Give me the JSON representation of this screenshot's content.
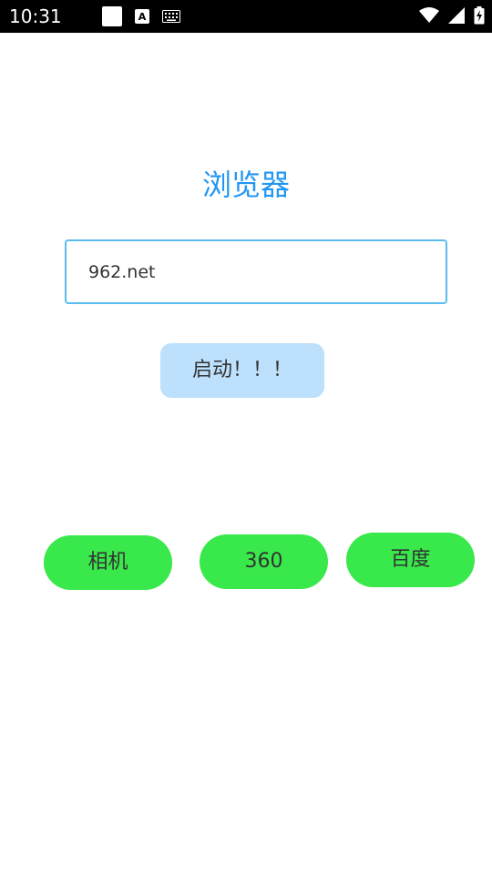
{
  "status_bar": {
    "time": "10:31",
    "a_icon_label": "A"
  },
  "title": "浏览器",
  "url_input": {
    "value": "962.net"
  },
  "launch_button": {
    "label": "启动！！！"
  },
  "shortcuts": {
    "camera": "相机",
    "b360": "360",
    "baidu": "百度"
  },
  "colors": {
    "title": "#2196F3",
    "input_border": "#5bbcef",
    "launch_bg": "#bde0fc",
    "shortcut_bg": "#39e84a"
  }
}
